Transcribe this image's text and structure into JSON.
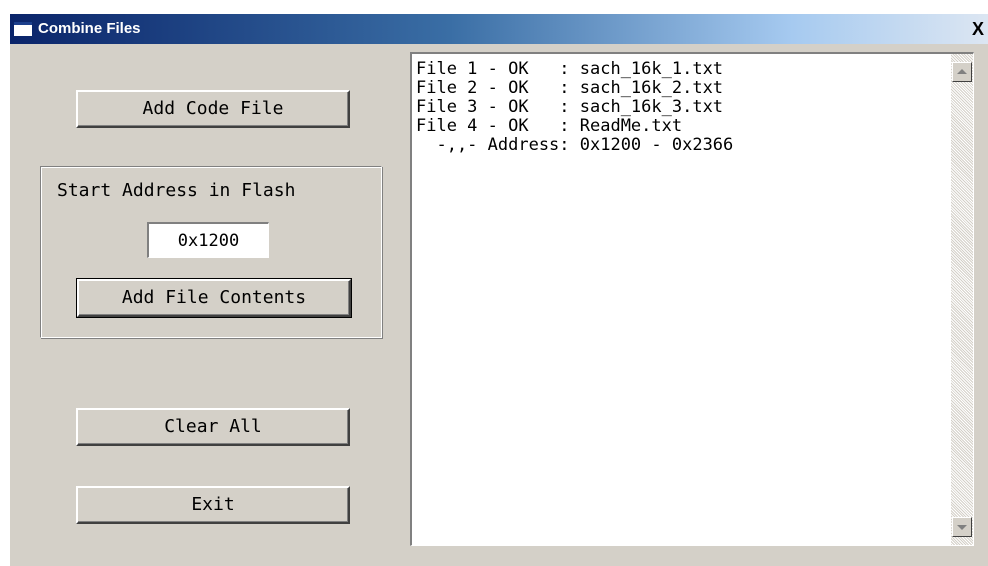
{
  "window": {
    "title": "Combine Files",
    "close_label": "X"
  },
  "buttons": {
    "add_code_file": "Add Code File",
    "add_file_contents": "Add File Contents",
    "clear_all": "Clear All",
    "exit": "Exit"
  },
  "start_address": {
    "label": "Start Address in Flash",
    "value": "0x1200"
  },
  "output_list": {
    "lines": [
      "File 1 - OK   : sach_16k_1.txt",
      "File 2 - OK   : sach_16k_2.txt",
      "File 3 - OK   : sach_16k_3.txt",
      "File 4 - OK   : ReadMe.txt",
      "  -,,- Address: 0x1200 - 0x2366"
    ]
  },
  "icons": {
    "window_icon": "window-icon",
    "close": "close-icon",
    "scroll_up": "scroll-up-arrow-icon",
    "scroll_down": "scroll-down-arrow-icon"
  },
  "colors": {
    "dialog_face": "#d4d0c8",
    "titlebar_start": "#0a246a",
    "titlebar_end": "#dce6f2",
    "list_background": "#ffffff"
  }
}
